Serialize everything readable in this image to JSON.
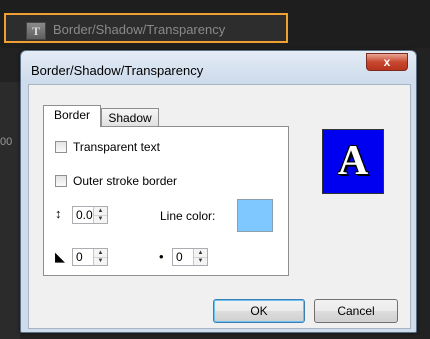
{
  "toolbar": {
    "icon": "text-tool-icon",
    "icon_glyph": "T",
    "label": "Border/Shadow/Transparency"
  },
  "background": {
    "edge_glyph": "00"
  },
  "dialog": {
    "title": "Border/Shadow/Transparency",
    "close_glyph": "x",
    "tabs": [
      {
        "label": "Border",
        "active": true
      },
      {
        "label": "Shadow",
        "active": false
      }
    ],
    "border_tab": {
      "transparent_text": {
        "label": "Transparent text",
        "checked": false
      },
      "outer_stroke": {
        "label": "Outer stroke border",
        "checked": false
      },
      "stroke_width": {
        "icon": "line-spacing-icon",
        "icon_glyph": "↕",
        "value": "0.0"
      },
      "line_color": {
        "label": "Line color:",
        "color": "#7fc8ff"
      },
      "feather": {
        "icon": "corner-icon",
        "icon_glyph": "◣",
        "value": "0"
      },
      "blur": {
        "icon": "dot-icon",
        "icon_glyph": "•",
        "value": "0"
      }
    },
    "preview": {
      "glyph": "A",
      "background": "#0000f0"
    },
    "buttons": {
      "ok": "OK",
      "cancel": "Cancel"
    }
  }
}
